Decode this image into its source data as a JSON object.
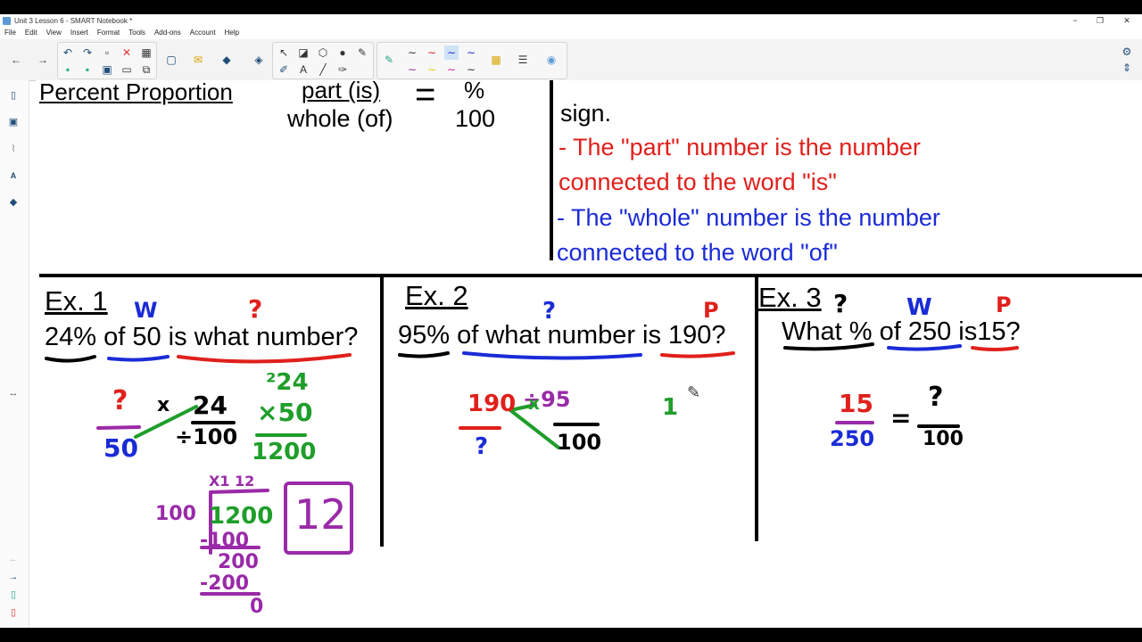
{
  "window": {
    "title": "Unit 3 Lesson 6 - SMART Notebook *",
    "controls": [
      "−",
      "❐",
      "✕"
    ]
  },
  "menu": [
    "File",
    "Edit",
    "View",
    "Insert",
    "Format",
    "Tools",
    "Add-ons",
    "Account",
    "Help"
  ],
  "header": {
    "title": "Percent Proportion",
    "formula_top": "part (is)",
    "formula_bottom": "whole (of)",
    "equals": "=",
    "percent_top": "%",
    "percent_bottom": "100",
    "sign_text": "sign.",
    "rule_part_1": "- The \"part\" number is the number",
    "rule_part_2": "connected to the word \"is\"",
    "rule_whole_1": "- The \"whole\" number is the number",
    "rule_whole_2": "connected to the word \"of\""
  },
  "examples": [
    {
      "label": "Ex. 1",
      "question": "24% of 50 is what number?",
      "ink": {
        "w": "W",
        "q": "?",
        "numq": "?",
        "den": "50",
        "x": "x",
        "top": "24",
        "div100": "÷100",
        "mult_top": "²24",
        "mult_mid": "×50",
        "mult_res": "1200",
        "long_top": "X1 12",
        "long_div": "100",
        "long_dividend": "1200",
        "s1": "-100",
        "r1": "200",
        "s2": "-200",
        "r2": "0",
        "answer": "12"
      }
    },
    {
      "label": "Ex. 2",
      "question": "95% of what number is 190?",
      "ink": {
        "q": "?",
        "p": "P",
        "num": "190",
        "den": "?",
        "top": "÷95",
        "bottom": "100",
        "x": "x",
        "one": "1"
      }
    },
    {
      "label": "Ex. 3",
      "question": "What % of 250 is15?",
      "ink": {
        "q": "?",
        "w": "W",
        "p": "P",
        "num": "15",
        "den": "250",
        "eq": "=",
        "top": "?",
        "bottom": "100"
      }
    }
  ],
  "colors": {
    "red": "#e0201b",
    "blue": "#1a2bd6",
    "green": "#1f9e2a",
    "purple": "#9a2aa8",
    "black": "#000000"
  }
}
